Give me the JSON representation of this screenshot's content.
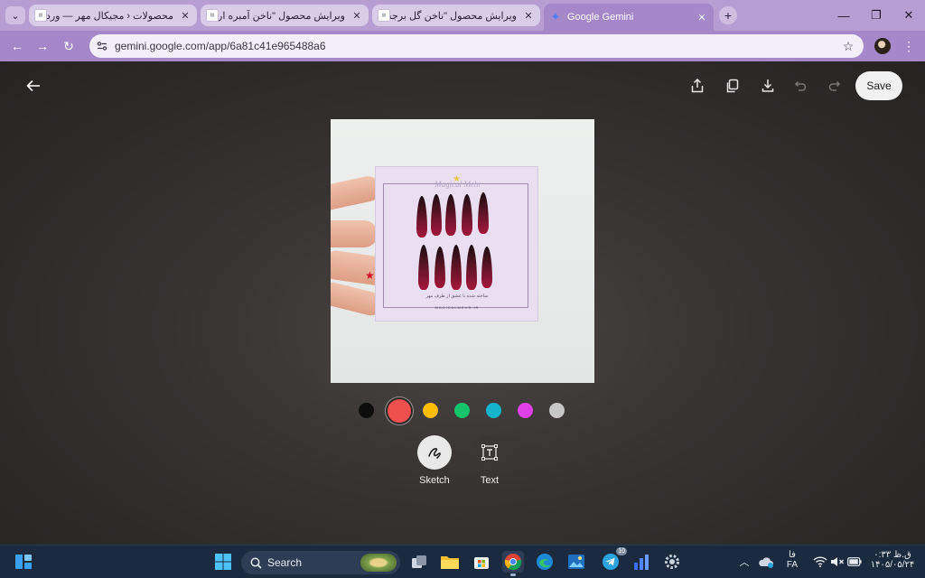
{
  "browser": {
    "tabs": [
      {
        "title": "محصولات ‹ مجیکال مهر — وردپرس",
        "active": false
      },
      {
        "title": "ویرایش محصول \"ناخن آمبره ارغوانی\"",
        "active": false
      },
      {
        "title": "ویرایش محصول \"ناخن گل برجسته\"",
        "active": false
      },
      {
        "title": "Google Gemini",
        "active": true
      }
    ],
    "url": "gemini.google.com/app/6a81c41e965488a6"
  },
  "editor": {
    "save_label": "Save",
    "image": {
      "card_logo": "Magical Mehr",
      "card_persian_line": "ساخته شده با عشق از طرف مهر",
      "card_brand": "MAGICALMEHR.IR"
    },
    "colors": [
      "#0d0d0d",
      "#f04f4f",
      "#fbbc04",
      "#14c46a",
      "#12b5cb",
      "#e040e8",
      "#c7c7c7"
    ],
    "selected_color_index": 1,
    "modes": [
      {
        "label": "Sketch",
        "active": true
      },
      {
        "label": "Text",
        "active": false
      }
    ]
  },
  "taskbar": {
    "search_label": "Search",
    "telegram_badge": "10",
    "lang_top": "فا",
    "lang_bottom": "FA",
    "time": "۰:۳۳ ق.ظ",
    "date": "۱۴۰۵/۰۵/۲۴"
  }
}
